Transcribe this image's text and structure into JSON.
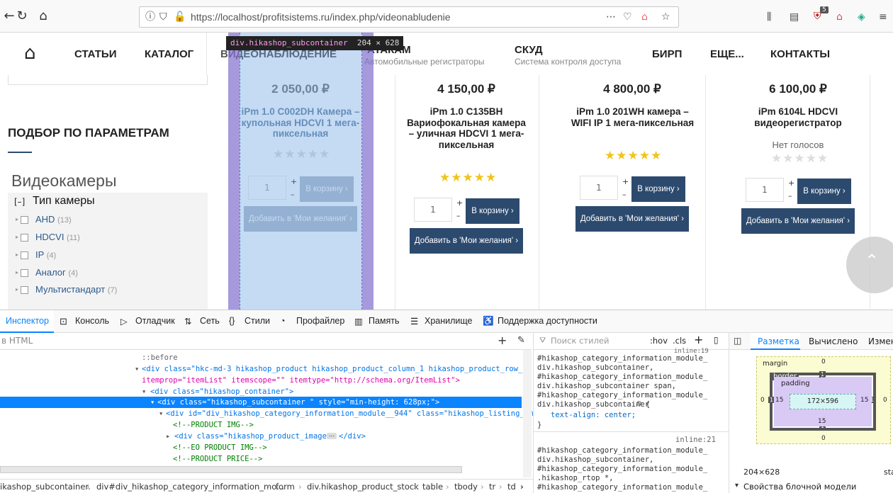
{
  "browser": {
    "url": "https://localhost/profitsistems.ru/index.php/videonabludenie",
    "badge_count": "5"
  },
  "nav": {
    "items": [
      "СТАТЬИ",
      "КАТАЛОГ",
      "ВИДЕОНАБЛЮДЕНИЕ",
      "АТАКАМ",
      "СКУД",
      "БИРП",
      "ЕЩЕ...",
      "КОНТАКТЫ"
    ],
    "sub_dvr": "Автомобильные регистраторы",
    "sub_skud": "Система контроля доступа"
  },
  "sidebar": {
    "heading": "ПОДБОР ПО ПАРАМЕТРАМ",
    "category": "Видеокамеры",
    "group_toggle": "[–]",
    "group_label": "Тип камеры",
    "filters": [
      {
        "label": "AHD",
        "count": "(13)"
      },
      {
        "label": "HDCVI",
        "count": "(11)"
      },
      {
        "label": "IP",
        "count": "(4)"
      },
      {
        "label": "Аналог",
        "count": "(4)"
      },
      {
        "label": "Мультистандарт",
        "count": "(7)"
      }
    ]
  },
  "products": [
    {
      "price": "2 050,00 ₽",
      "name": "iPm 1.0 C002DH Камера – купольная HDCVI 1 мега-пиксельная",
      "rating": 0,
      "votes": "",
      "qty": "1",
      "cart": "В корзину",
      "wish": "Добавить в 'Мои желания'"
    },
    {
      "price": "4 150,00 ₽",
      "name": "iPm 1.0 C135BH Вариофокальная камера – уличная HDCVI 1 мега-пиксельная",
      "rating": 5,
      "votes": "",
      "qty": "1",
      "cart": "В корзину",
      "wish": "Добавить в 'Мои желания'"
    },
    {
      "price": "4 800,00 ₽",
      "name": "iPm 1.0 201WH камера – WIFI IP 1 мега-пиксельная",
      "rating": 5,
      "votes": "",
      "qty": "1",
      "cart": "В корзину",
      "wish": "Добавить в 'Мои желания'"
    },
    {
      "price": "6 100,00 ₽",
      "name": "iPm 6104L HDCVI видеорегистратор",
      "rating": 0,
      "votes": "Нет голосов",
      "qty": "1",
      "cart": "В корзину",
      "wish": "Добавить в 'Мои желания'"
    }
  ],
  "tooltip": {
    "selector": "div.hikashop_subcontainer",
    "size": "204 × 628"
  },
  "devtools": {
    "tabs": [
      "Инспектор",
      "Консоль",
      "Отладчик",
      "Сеть",
      "Стили",
      "Профайлер",
      "Память",
      "Хранилище",
      "Поддержка доступности"
    ],
    "search_html": "в HTML",
    "search_styles": "Поиск стилей",
    "hov": ":hov",
    "cls": ".cls",
    "right_tabs": [
      "Разметка",
      "Вычислено",
      "Измен"
    ],
    "html_lines": [
      "::before",
      "<div class=\"hkc-md-3 hikashop_product hikashop_product_column_1 hikashop_product_row_1\"",
      "itemprop=\"itemList\" itemscope=\"\" itemtype=\"http://schema.org/ItemList\">",
      "<div class=\"hikashop_container\">",
      "<div class=\"hikashop_subcontainer \" style=\"min-height: 628px;\">",
      "<div id=\"div_hikashop_category_information_module__944\" class=\"hikashop_listing_img_",
      "<!--PRODUCT IMG-->",
      "<div class=\"hikashop_product_image\">",
      "</div>",
      "<!--EO PRODUCT IMG-->",
      "<!--PRODUCT PRICE-->"
    ],
    "css_rule1": "#hikashop_category_information_module_\ndiv.hikashop_subcontainer,\n#hikashop_category_information_module_\ndiv.hikashop_subcontainer span,\n#hikashop_category_information_module_\ndiv.hikashop_subcontainer",
    "css_open": "{",
    "css_prop": "text-align: center;",
    "css_close": "}",
    "inline_top": "inline:19",
    "inline_21": "inline:21",
    "css_rule2": "#hikashop_category_information_module_\ndiv.hikashop_subcontainer,\n#hikashop_category_information_module_\n.hikashop_rtop *,\n#hikashop_category_information_module_",
    "box": {
      "margin_label": "margin",
      "border_label": "border",
      "padding_label": "padding",
      "margin_top": "0",
      "margin_bottom": "0",
      "margin_left": "0",
      "margin_right": "0",
      "border": "1",
      "padding_top": "15",
      "padding_bottom": "15",
      "padding_left": "15",
      "padding_right": "15",
      "content": "172×596"
    },
    "dims": "204×628",
    "position_short": "sta",
    "box_model_props": "Свойства блочной модели",
    "breadcrumbs": [
      "ikashop_subcontainer.",
      "div#div_hikashop_category_information_mo...",
      "form",
      "div.hikashop_product_stock",
      "table",
      "tbody",
      "tr",
      "td"
    ]
  }
}
